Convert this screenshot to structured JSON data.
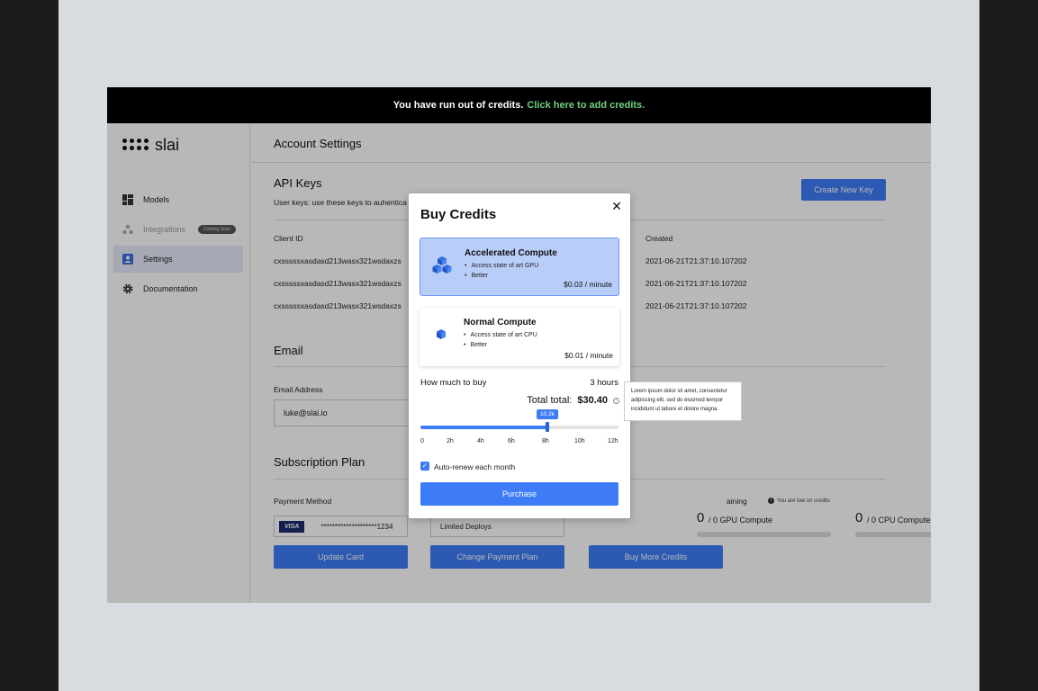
{
  "banner": {
    "message": "You have run out of credits.",
    "link": "Click here to add credits."
  },
  "brand": {
    "name": "slai"
  },
  "sidebar": {
    "items": [
      {
        "label": "Models",
        "icon": "dashboard-icon"
      },
      {
        "label": "Integrations",
        "icon": "integrations-icon",
        "badge": "Coming Soon"
      },
      {
        "label": "Settings",
        "icon": "user-badge-icon"
      },
      {
        "label": "Documentation",
        "icon": "gear-icon"
      }
    ]
  },
  "page": {
    "title": "Account Settings"
  },
  "api_keys": {
    "title": "API Keys",
    "description": "User keys: use these keys to auhentica",
    "create_button": "Create New Key",
    "col_client": "Client ID",
    "col_created": "Created",
    "rows": [
      {
        "client": "cxsssssxasdasd213wasx321wsdaxzs",
        "created": "2021-06-21T21:37:10.107202"
      },
      {
        "client": "cxsssssxasdasd213wasx321wsdaxzs",
        "created": "2021-06-21T21:37:10.107202"
      },
      {
        "client": "cxsssssxasdasd213wasx321wsdaxzs",
        "created": "2021-06-21T21:37:10.107202"
      }
    ]
  },
  "email": {
    "title": "Email",
    "label": "Email Address",
    "value": "luke@slai.io"
  },
  "subscription": {
    "title": "Subscription Plan",
    "payment_label": "Payment Method",
    "card_brand": "VISA",
    "card_number": "********************1234",
    "plan": "Limited Deploys",
    "remaining_label": "aining",
    "low_warning": "You are low on credits",
    "gpu_count": "0",
    "gpu_label": "/ 0 GPU Compute",
    "cpu_count": "0",
    "cpu_label": "/ 0 CPU Compute",
    "update_card": "Update Card",
    "change_plan": "Change Payment Plan",
    "buy_more": "Buy More Credits"
  },
  "modal": {
    "title": "Buy Credits",
    "options": [
      {
        "title": "Accelerated Compute",
        "bullets": [
          "Access state of art GPU",
          "Better"
        ],
        "price": "$0.03 / minute",
        "selected": true
      },
      {
        "title": "Normal Compute",
        "bullets": [
          "Access state of art CPU",
          "Better"
        ],
        "price": "$0.01 / minute",
        "selected": false
      }
    ],
    "how_much": "How much to buy",
    "hours": "3 hours",
    "total_label": "Total total:",
    "total_value": "$30.40",
    "slider_value": "10.2k",
    "slider_fraction": 0.64,
    "ticks": [
      "0",
      "2h",
      "4h",
      "6h",
      "8h",
      "10h",
      "12h"
    ],
    "auto_renew": "Auto-renew each month",
    "auto_renew_checked": true,
    "purchase": "Purchase",
    "tooltip": "Lorem ipsum dolor sit amet, consectetur adipiscing elit, sed do eiusmod tempor incididunt ut labore et dolore magna."
  },
  "colors": {
    "accent": "#3d7cf6",
    "banner_link": "#6fcf7f",
    "selected_card": "#b9cdf9"
  }
}
